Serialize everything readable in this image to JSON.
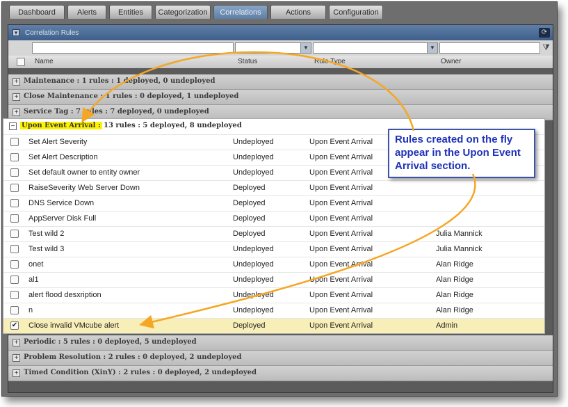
{
  "tabs": [
    {
      "label": "Dashboard",
      "active": false
    },
    {
      "label": "Alerts",
      "active": false
    },
    {
      "label": "Entities",
      "active": false
    },
    {
      "label": "Categorization",
      "active": false
    },
    {
      "label": "Correlations",
      "active": true
    },
    {
      "label": "Actions",
      "active": false
    },
    {
      "label": "Configuration",
      "active": false
    }
  ],
  "panel": {
    "title": "Correlation Rules"
  },
  "columns": {
    "name": "Name",
    "status": "Status",
    "rule_type": "Rule Type",
    "owner": "Owner"
  },
  "groups_top": [
    {
      "label": "Maintenance : 1 rules : 1 deployed, 0 undeployed"
    },
    {
      "label": "Close Maintenance : 1 rules : 0 deployed, 1 undeployed"
    },
    {
      "label": "Service Tag : 7 rules : 7 deployed, 0 undeployed"
    }
  ],
  "expanded_group": {
    "highlight": "Upon Event Arrival :",
    "summary": "13 rules : 5 deployed, 8 undeployed",
    "rows": [
      {
        "name": "Set Alert Severity",
        "status": "Undeployed",
        "type": "Upon Event Arrival",
        "owner": "",
        "checked": false
      },
      {
        "name": "Set Alert Description",
        "status": "Undeployed",
        "type": "Upon Event Arrival",
        "owner": "",
        "checked": false
      },
      {
        "name": "Set default owner to entity owner",
        "status": "Undeployed",
        "type": "Upon Event Arrival",
        "owner": "",
        "checked": false
      },
      {
        "name": "RaiseSeverity Web Server Down",
        "status": "Deployed",
        "type": "Upon Event Arrival",
        "owner": "",
        "checked": false
      },
      {
        "name": "DNS Service Down",
        "status": "Deployed",
        "type": "Upon Event Arrival",
        "owner": "",
        "checked": false
      },
      {
        "name": "AppServer Disk Full",
        "status": "Deployed",
        "type": "Upon Event Arrival",
        "owner": "",
        "checked": false
      },
      {
        "name": "Test wild 2",
        "status": "Deployed",
        "type": "Upon Event Arrival",
        "owner": "Julia Mannick",
        "checked": false
      },
      {
        "name": "Test wild 3",
        "status": "Undeployed",
        "type": "Upon Event Arrival",
        "owner": "Julia Mannick",
        "checked": false
      },
      {
        "name": "onet",
        "status": "Undeployed",
        "type": "Upon Event Arrival",
        "owner": "Alan Ridge",
        "checked": false
      },
      {
        "name": "al1",
        "status": "Undeployed",
        "type": "Upon Event Arrival",
        "owner": "Alan Ridge",
        "checked": false
      },
      {
        "name": "alert flood desxription",
        "status": "Undeployed",
        "type": "Upon Event Arrival",
        "owner": "Alan Ridge",
        "checked": false
      },
      {
        "name": "n",
        "status": "Undeployed",
        "type": "Upon Event Arrival",
        "owner": "Alan Ridge",
        "checked": false
      },
      {
        "name": "Close invalid VMcube alert",
        "status": "Deployed",
        "type": "Upon Event Arrival",
        "owner": "Admin",
        "checked": true
      }
    ]
  },
  "groups_bottom": [
    {
      "label": "Periodic : 5 rules : 0 deployed, 5 undeployed"
    },
    {
      "label": "Problem Resolution : 2 rules : 0 deployed, 2 undeployed"
    },
    {
      "label": "Timed Condition (XinY) : 2 rules : 0 deployed, 2 undeployed"
    }
  ],
  "callout": {
    "text": "Rules created on the fly appear in the Upon Event Arrival section."
  },
  "colors": {
    "highlight": "#fff200",
    "callout_text": "#1f32b8",
    "arrow": "#f5a623",
    "selected_row": "#f8eeb8"
  }
}
